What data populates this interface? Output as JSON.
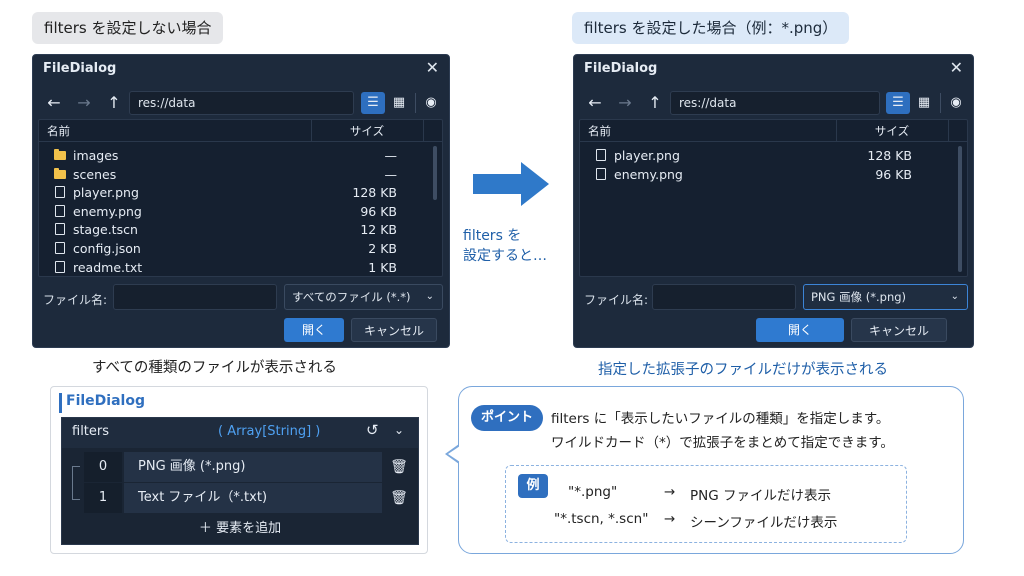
{
  "left_header": "filters を設定しない場合",
  "right_header": "filters を設定した場合（例：*.png）",
  "dialog_title": "FileDialog",
  "path": "res://data",
  "col_name": "名前",
  "col_size": "サイズ",
  "filename_label": "ファイル名:",
  "open_button": "開く",
  "cancel_button": "キャンセル",
  "left_dialog": {
    "filter": "すべてのファイル (*.*)",
    "files": [
      {
        "name": "images",
        "size": "—",
        "type": "folder"
      },
      {
        "name": "scenes",
        "size": "—",
        "type": "folder"
      },
      {
        "name": "player.png",
        "size": "128 KB",
        "type": "file"
      },
      {
        "name": "enemy.png",
        "size": "96 KB",
        "type": "file"
      },
      {
        "name": "stage.tscn",
        "size": "12 KB",
        "type": "file"
      },
      {
        "name": "config.json",
        "size": "2 KB",
        "type": "file"
      },
      {
        "name": "readme.txt",
        "size": "1 KB",
        "type": "file"
      }
    ]
  },
  "right_dialog": {
    "filter": "PNG 画像 (*.png)",
    "files": [
      {
        "name": "player.png",
        "size": "128 KB",
        "type": "file"
      },
      {
        "name": "enemy.png",
        "size": "96 KB",
        "type": "file"
      }
    ]
  },
  "middle_text": [
    "filters を",
    "設定すると…"
  ],
  "caption_left": "すべての種類のファイルが表示される",
  "caption_right": "指定した拡張子のファイルだけが表示される",
  "inspector": {
    "title": "FileDialog",
    "property": "filters",
    "type": "( Array[String] )",
    "items": [
      {
        "index": "0",
        "value": "PNG 画像 (*.png)"
      },
      {
        "index": "1",
        "value": "Text ファイル（*.txt)"
      }
    ],
    "add": "要素を追加"
  },
  "callout": {
    "badge": "ポイント",
    "line1": "filters に「表示したいファイルの種類」を指定します。",
    "line2": "ワイルドカード（*）で拡張子をまとめて指定できます。",
    "example_badge": "例",
    "examples": [
      {
        "pattern": "\"*.png\"",
        "arrow": "→",
        "result": "PNG ファイルだけ表示"
      },
      {
        "pattern": "\"*.tscn, *.scn\"",
        "arrow": "→",
        "result": "シーンファイルだけ表示"
      }
    ]
  },
  "icons": {
    "back": "←",
    "forward": "→",
    "up": "↑",
    "list": "☰",
    "grid": "▦",
    "eye": "◉",
    "close": "✕",
    "chevron": "⌄",
    "reset": "↺",
    "trash": "🗑",
    "plus": "＋"
  },
  "colors": {
    "accent": "#2f6fbf",
    "dialog_bg": "#1d2a3c",
    "folder": "#f2c24b"
  }
}
